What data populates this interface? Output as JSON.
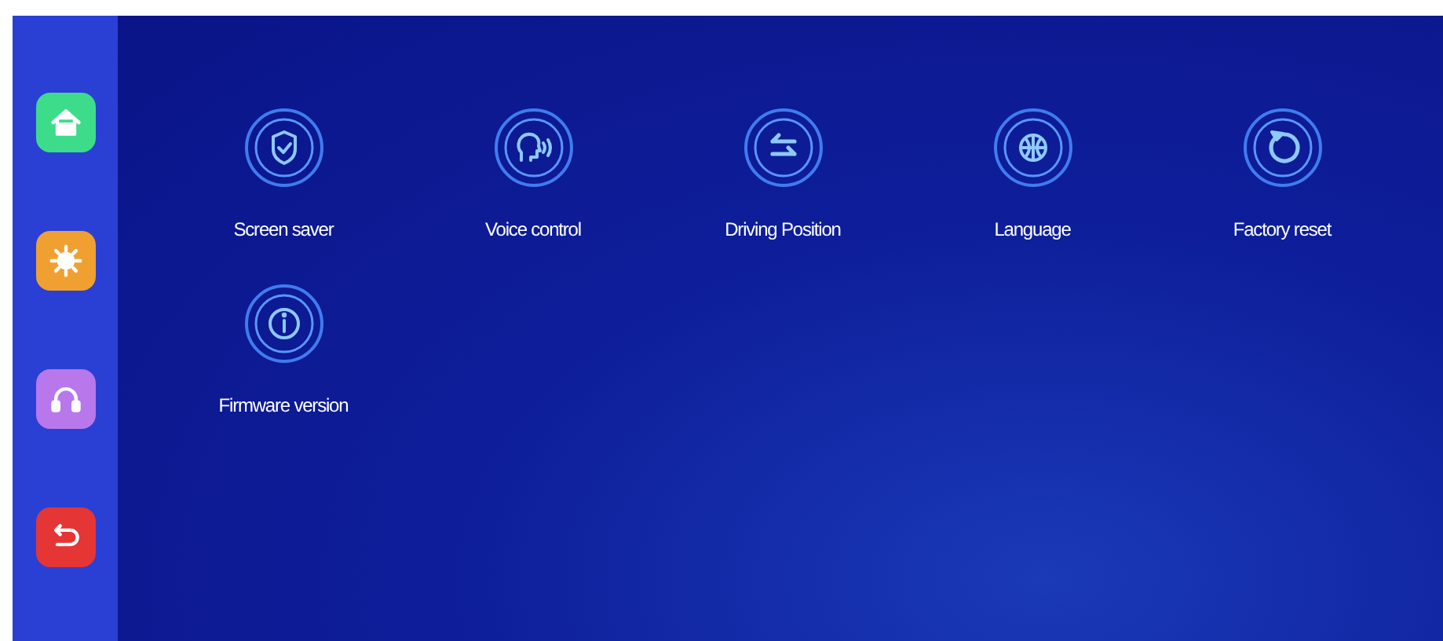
{
  "sidebar": {
    "items": [
      {
        "kind": "home",
        "color": "#3ddc8a"
      },
      {
        "kind": "display",
        "color": "#f0a030"
      },
      {
        "kind": "audio",
        "color": "#b878ec"
      },
      {
        "kind": "back",
        "color": "#e53535"
      }
    ]
  },
  "settings": [
    {
      "kind": "shield",
      "label": "Screen saver"
    },
    {
      "kind": "voice",
      "label": "Voice control"
    },
    {
      "kind": "swap",
      "label": "Driving Position"
    },
    {
      "kind": "globe",
      "label": "Language"
    },
    {
      "kind": "reset",
      "label": "Factory reset"
    },
    {
      "kind": "info",
      "label": "Firmware version"
    }
  ]
}
